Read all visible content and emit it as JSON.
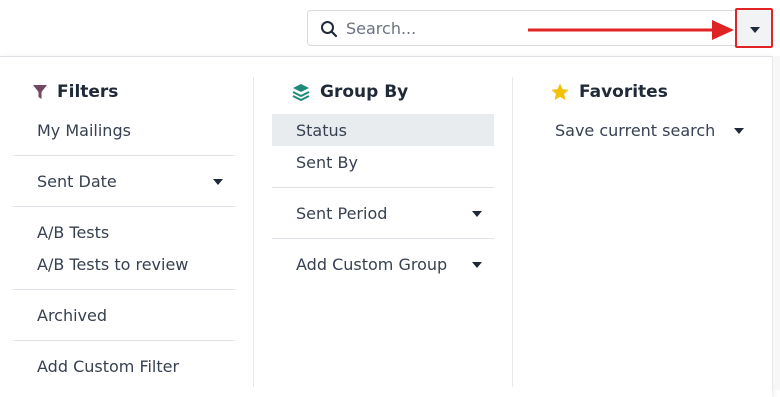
{
  "search": {
    "placeholder": "Search..."
  },
  "colors": {
    "filters_icon": "#71485f",
    "groupby_icon": "#1f8a7a",
    "favorites_icon": "#f3c10a",
    "annotation": "#e02424"
  },
  "filters": {
    "title": "Filters",
    "items": [
      "My Mailings",
      "Sent Date",
      "A/B Tests",
      "A/B Tests to review",
      "Archived",
      "Add Custom Filter"
    ]
  },
  "group_by": {
    "title": "Group By",
    "items": [
      "Status",
      "Sent By",
      "Sent Period",
      "Add Custom Group"
    ]
  },
  "favorites": {
    "title": "Favorites",
    "items": [
      "Save current search"
    ]
  }
}
